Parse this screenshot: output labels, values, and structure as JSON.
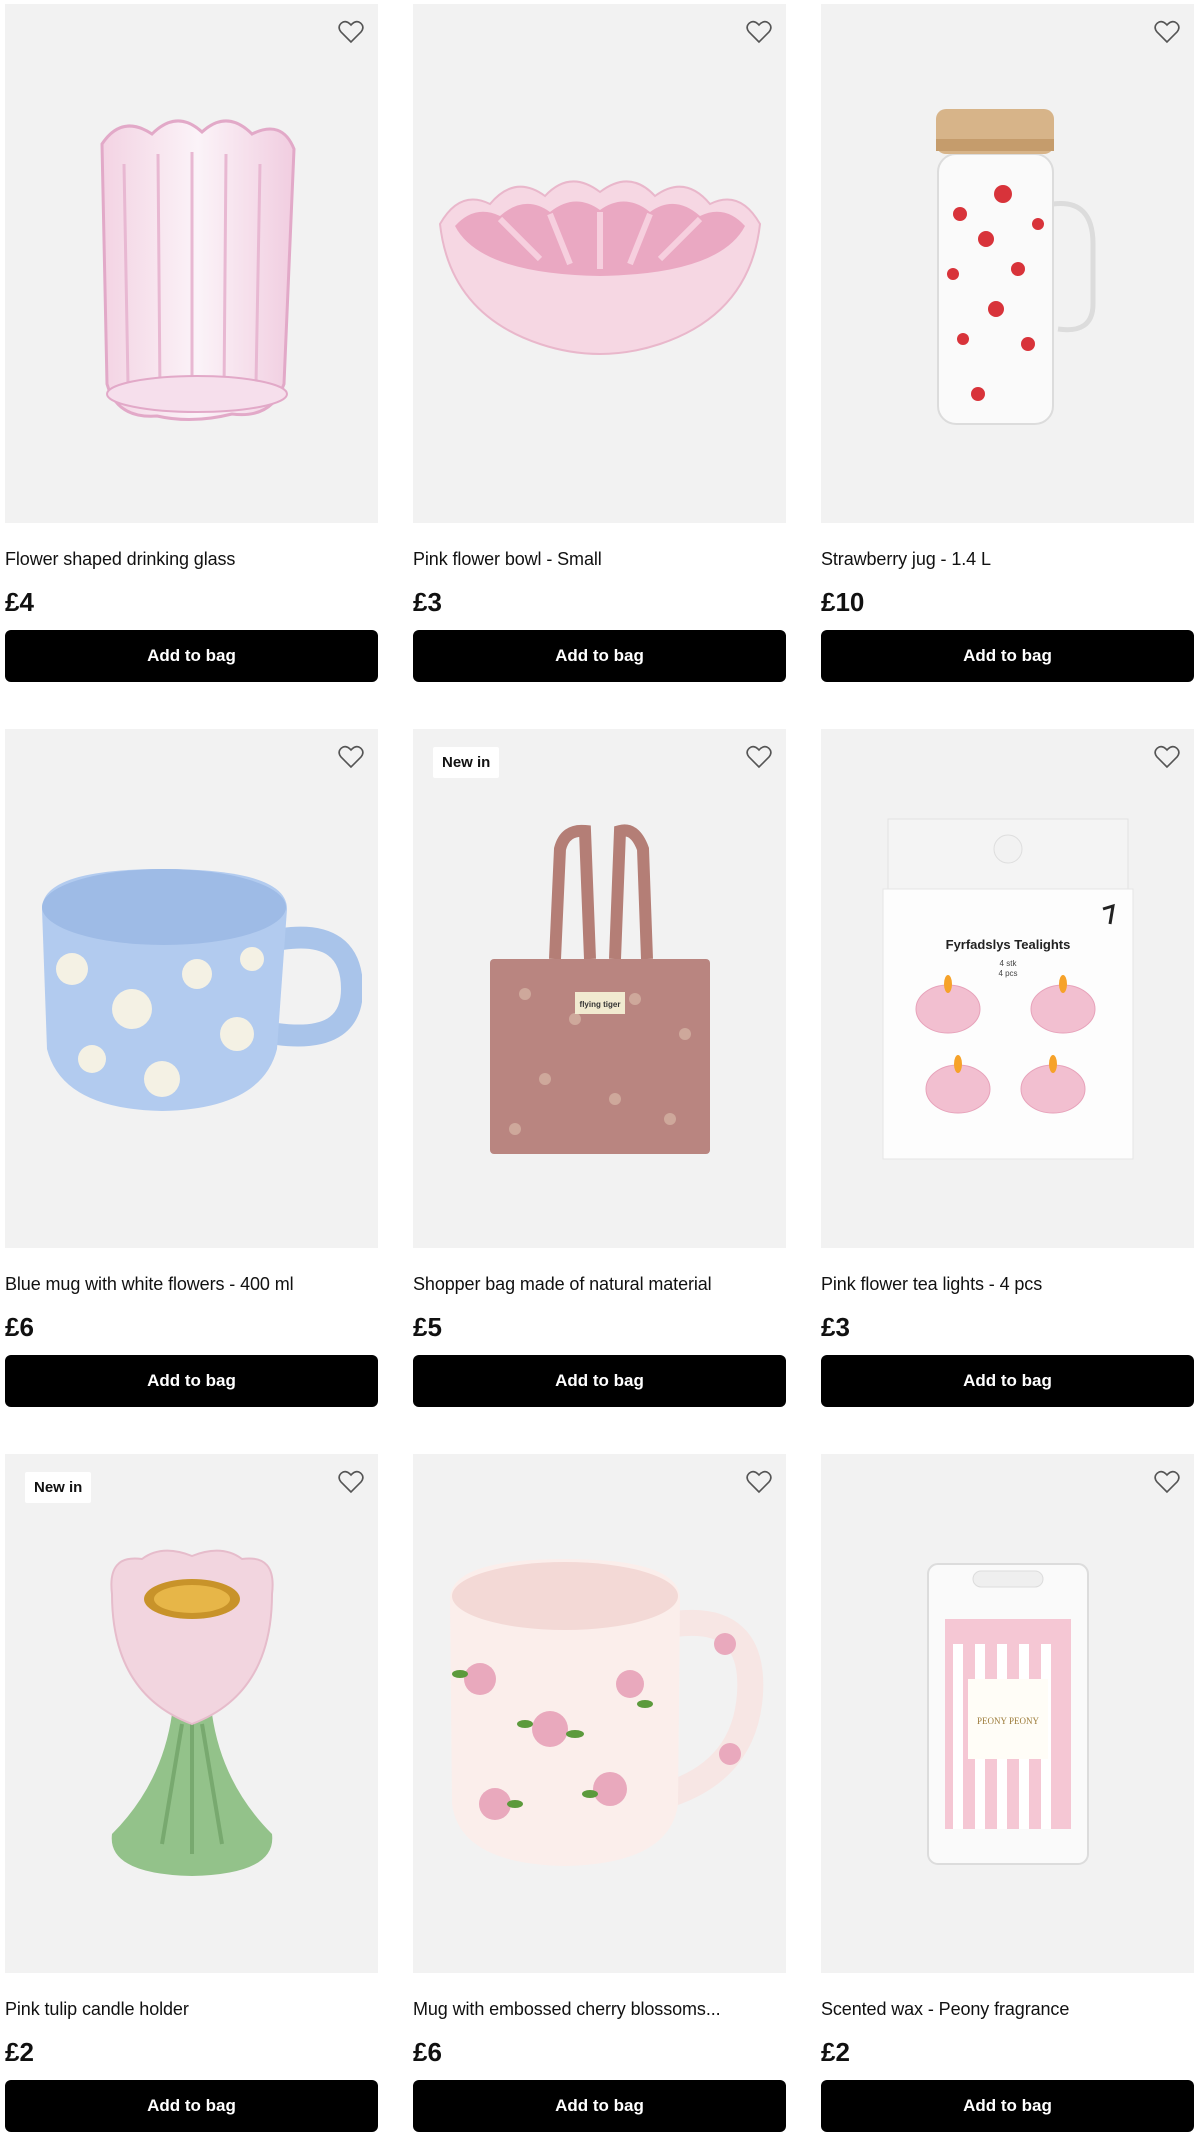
{
  "products": [
    {
      "name": "Flower shaped drinking glass",
      "price": "£4",
      "badge": "",
      "image_icon": "flower-glass-image",
      "button": "Add to bag"
    },
    {
      "name": "Pink flower bowl - Small",
      "price": "£3",
      "badge": "",
      "image_icon": "flower-bowl-image",
      "button": "Add to bag"
    },
    {
      "name": "Strawberry jug - 1.4 L",
      "price": "£10",
      "badge": "",
      "image_icon": "strawberry-jug-image",
      "button": "Add to bag"
    },
    {
      "name": "Blue mug with white flowers - 400 ml",
      "price": "£6",
      "badge": "",
      "image_icon": "blue-mug-image",
      "button": "Add to bag"
    },
    {
      "name": "Shopper bag made of natural material",
      "price": "£5",
      "badge": "New in",
      "image_icon": "shopper-bag-image",
      "button": "Add to bag",
      "bag_label": "flying tiger"
    },
    {
      "name": "Pink flower tea lights - 4 pcs",
      "price": "£3",
      "badge": "",
      "image_icon": "tealights-pack-image",
      "button": "Add to bag",
      "pack_title": "Fyrfadslys Tealights",
      "pack_sub1": "4 stk",
      "pack_sub2": "4 pcs"
    },
    {
      "name": "Pink tulip candle holder",
      "price": "£2",
      "badge": "New in",
      "image_icon": "tulip-candle-holder-image",
      "button": "Add to bag"
    },
    {
      "name": "Mug with embossed cherry blossoms...",
      "price": "£6",
      "badge": "",
      "image_icon": "cherry-blossom-mug-image",
      "button": "Add to bag"
    },
    {
      "name": "Scented wax - Peony fragrance",
      "price": "£2",
      "badge": "",
      "image_icon": "scented-wax-image",
      "button": "Add to bag",
      "label": "PEONY PEONY"
    }
  ],
  "colors": {
    "card_bg": "#f2f2f2",
    "button_bg": "#000000",
    "button_text": "#ffffff"
  }
}
